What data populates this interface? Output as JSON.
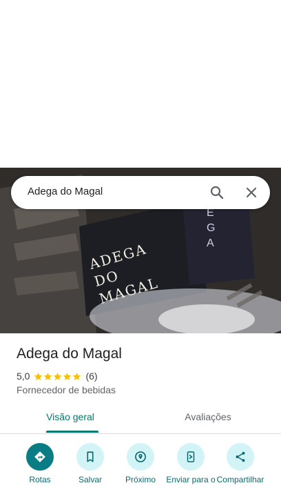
{
  "search": {
    "query": "Adega do Magal"
  },
  "photo": {
    "sign_text": "ADEGA DO MAGAL",
    "side_sign_text": "EGA"
  },
  "place": {
    "name": "Adega do Magal",
    "rating": "5,0",
    "stars": 5,
    "review_count": "(6)",
    "category": "Fornecedor de bebidas"
  },
  "tabs": [
    {
      "label": "Visão geral",
      "active": true
    },
    {
      "label": "Avaliações",
      "active": false
    }
  ],
  "actions": [
    {
      "label": "Rotas",
      "icon": "directions-icon"
    },
    {
      "label": "Salvar",
      "icon": "bookmark-icon"
    },
    {
      "label": "Próximo",
      "icon": "nearby-icon"
    },
    {
      "label": "Enviar para o",
      "icon": "send-to-phone-icon"
    },
    {
      "label": "Compartilhar",
      "icon": "share-icon"
    }
  ],
  "colors": {
    "accent": "#00796b",
    "primary_action": "#0a7d84",
    "action_bg": "#d2f4f7",
    "star": "#fbbc04"
  }
}
